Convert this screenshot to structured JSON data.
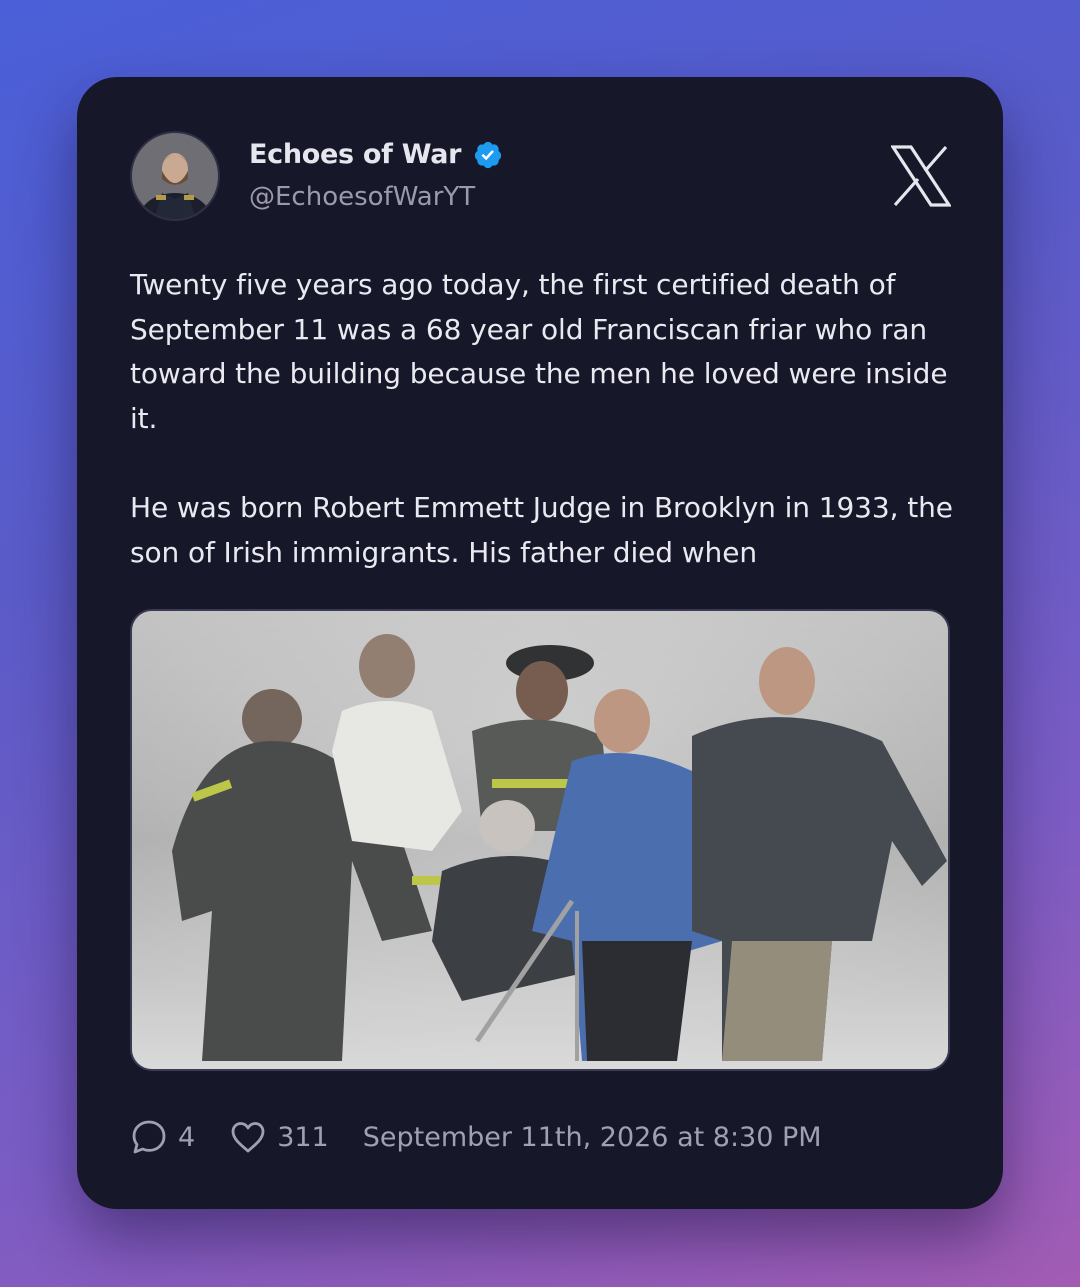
{
  "author": {
    "name": "Echoes of War",
    "handle": "@EchoesofWarYT",
    "verified": true,
    "avatar_icon": "portrait-avatar"
  },
  "platform_icon": "x-logo-icon",
  "tweet": {
    "paragraphs": [
      "Twenty five years ago today, the first certified death of September 11 was a 68 year old Franciscan friar who ran toward the building because the men he loved were inside it.",
      "He was born Robert Emmett Judge in Brooklyn in 1933, the son of Irish immigrants. His father died when"
    ]
  },
  "media": {
    "type": "photo",
    "icon": "photo-image"
  },
  "stats": {
    "replies": "4",
    "likes": "311",
    "timestamp": "September 11th, 2026 at 8:30 PM",
    "reply_icon": "comment-icon",
    "like_icon": "heart-icon"
  },
  "colors": {
    "card_bg": "#17172a",
    "verified_blue": "#1d9bf0",
    "text": "#e9e9f0",
    "muted": "#9fa0b2"
  }
}
